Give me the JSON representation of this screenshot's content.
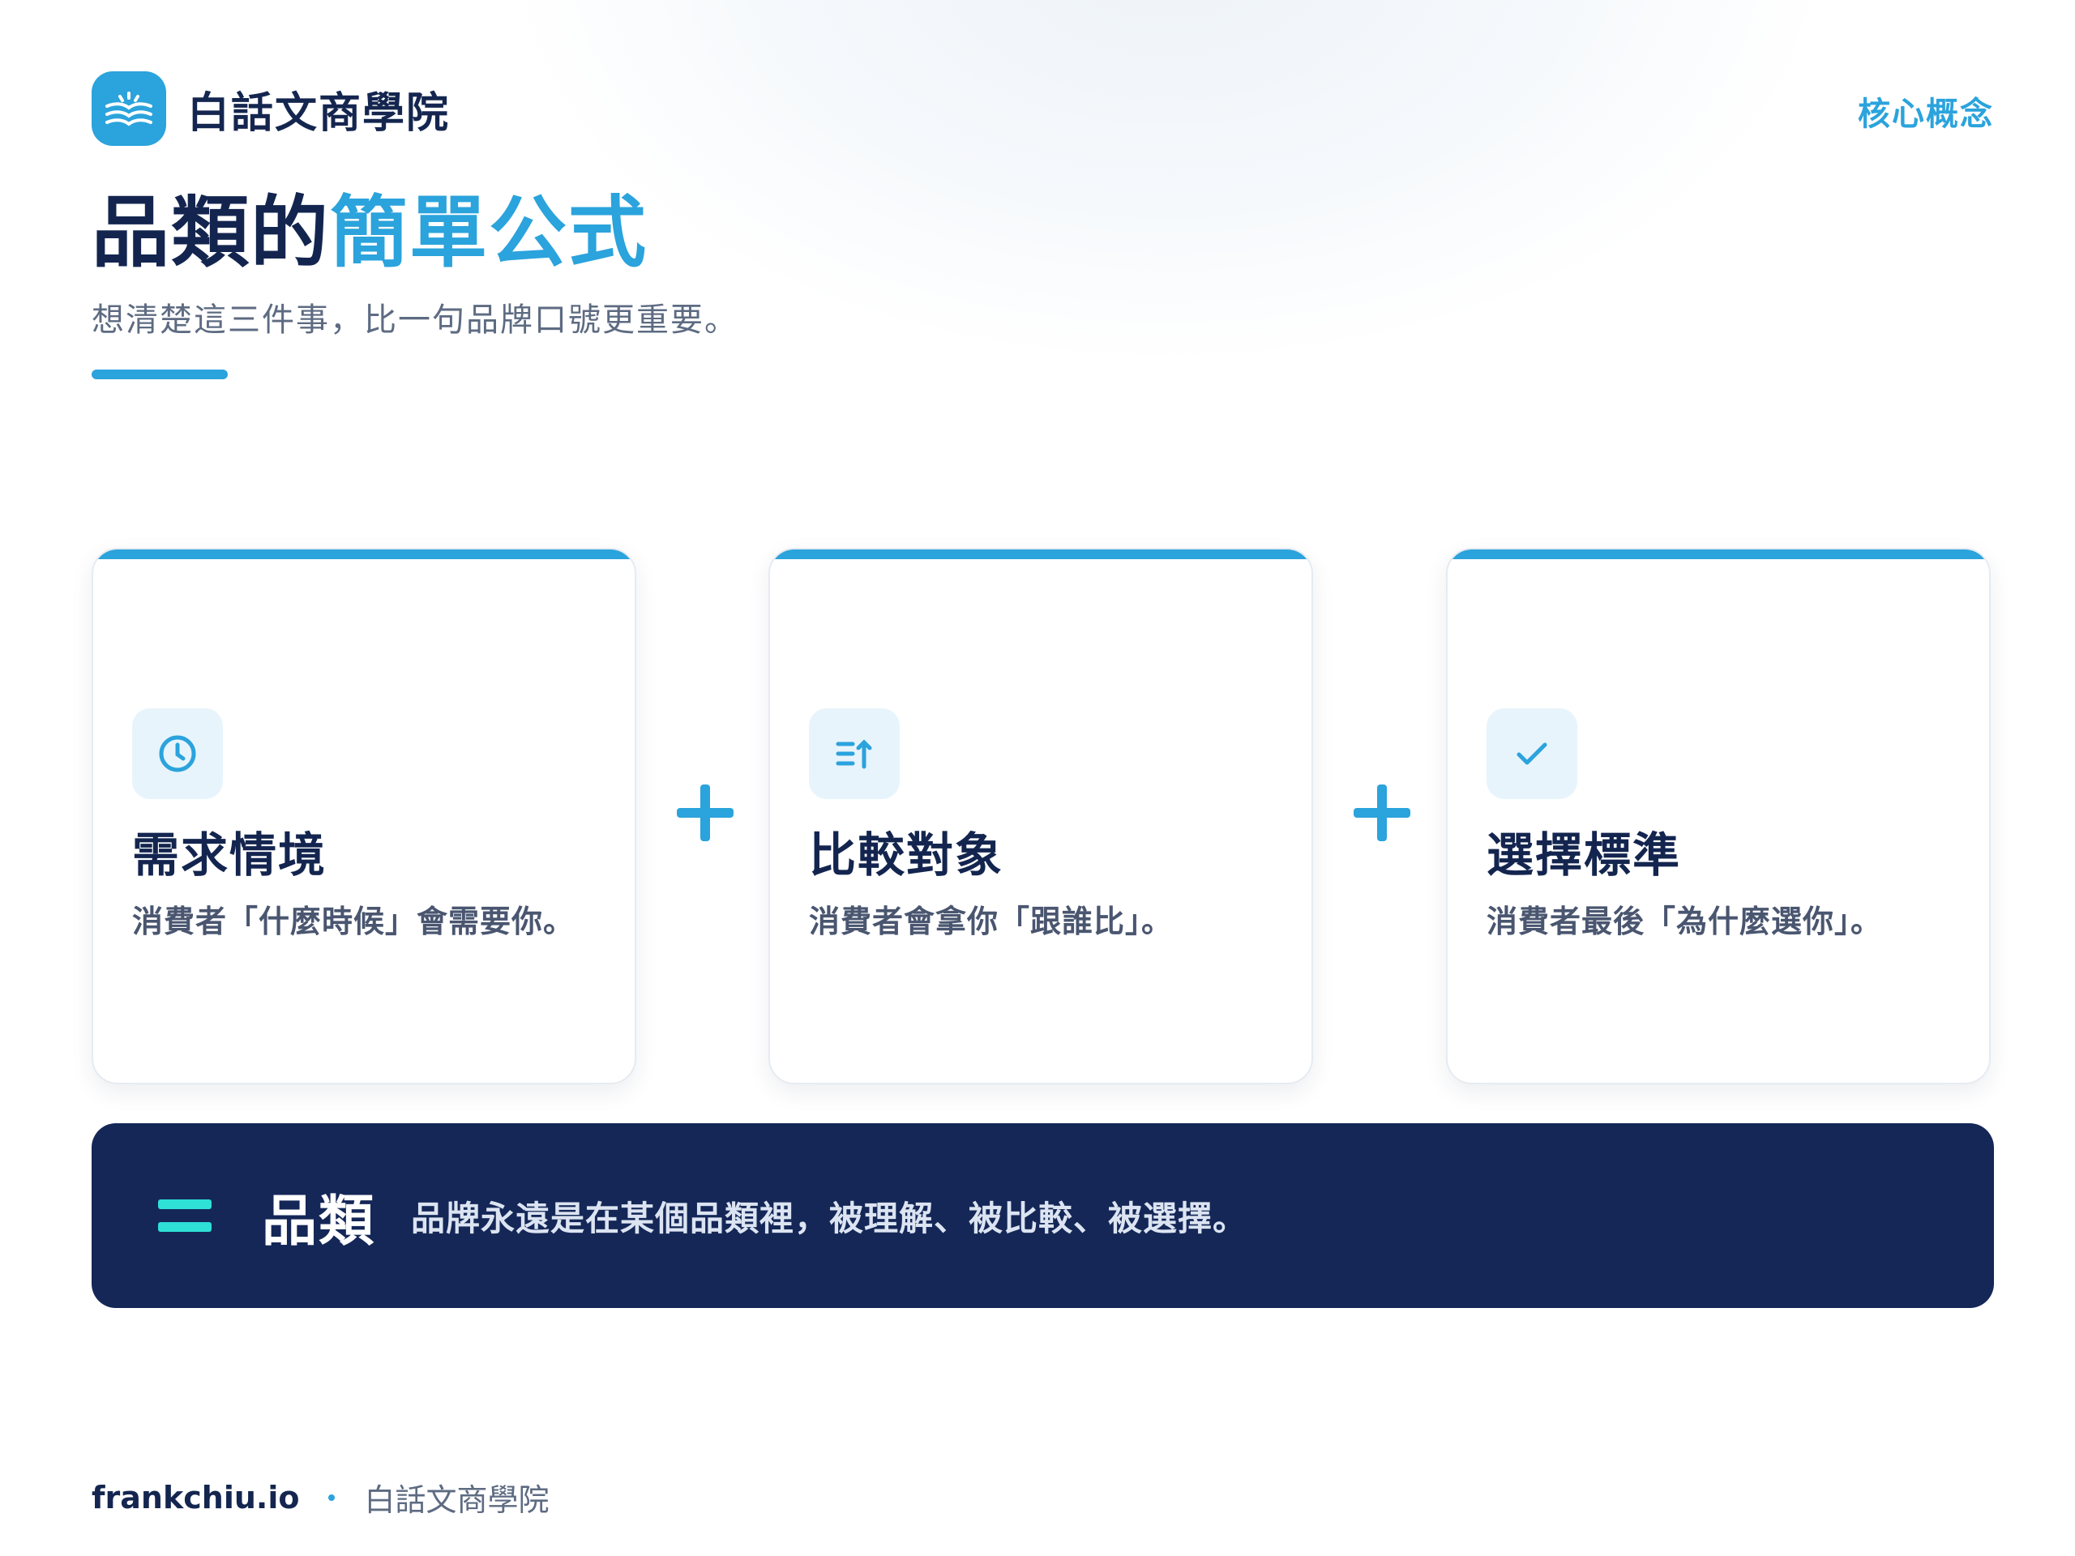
{
  "header": {
    "brand_name": "白話文商學院",
    "topic_tag": "核心概念"
  },
  "hero": {
    "title_part1": "品類的",
    "title_part2": "簡單公式",
    "subtitle": "想清楚這三件事，比一句品牌口號更重要。"
  },
  "cards": [
    {
      "icon": "clock-icon",
      "title": "需求情境",
      "desc": "消費者「什麼時候」會需要你。"
    },
    {
      "icon": "sort-arrows-icon",
      "title": "比較對象",
      "desc": "消費者會拿你「跟誰比」。"
    },
    {
      "icon": "check-icon",
      "title": "選擇標準",
      "desc": "消費者最後「為什麼選你」。"
    }
  ],
  "result": {
    "title": "品類",
    "text": "品牌永遠是在某個品類裡，被理解、被比較、被選擇。"
  },
  "footer": {
    "site": "frankchiu.io",
    "brand": "白話文商學院"
  },
  "colors": {
    "accent": "#2ba3dc",
    "navy": "#142757",
    "teal": "#2fe0d7"
  }
}
